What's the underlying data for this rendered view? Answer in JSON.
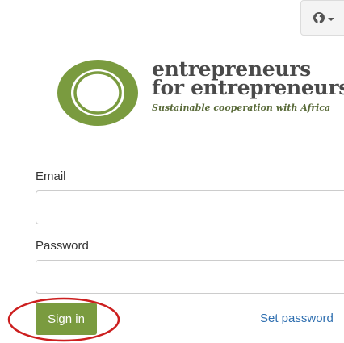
{
  "header": {
    "language_icon": "globe-icon"
  },
  "logo": {
    "line1": "entrepreneurs",
    "line2": "for entrepreneurs",
    "tagline": "Sustainable cooperation with Africa",
    "brand_color": "#7a9b3f"
  },
  "form": {
    "email_label": "Email",
    "email_value": "",
    "password_label": "Password",
    "password_value": "",
    "signin_label": "Sign in",
    "set_password_label": "Set password"
  },
  "colors": {
    "accent": "#7a9b3f",
    "link": "#2f6fb0",
    "annotation": "#cc1f1f"
  }
}
